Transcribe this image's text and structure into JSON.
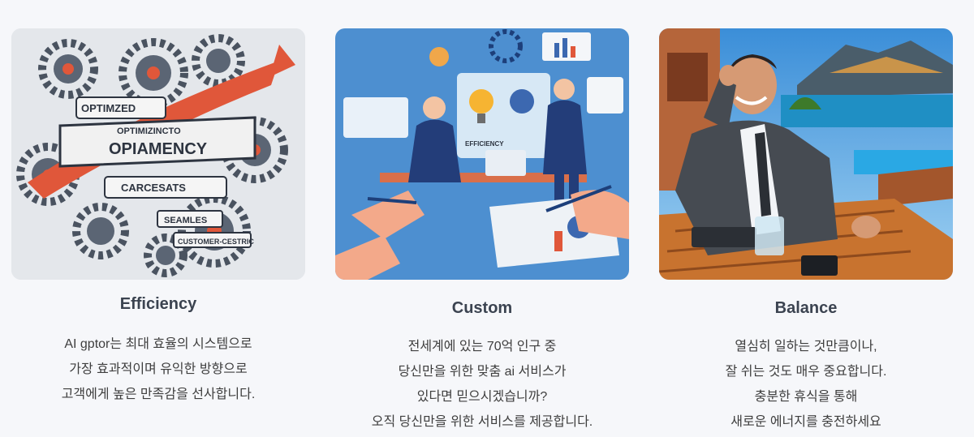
{
  "cards": [
    {
      "title": "Efficiency",
      "image_alt": "gears illustration",
      "image_words": [
        "OPTIMZED",
        "OPTIMIZINCTO",
        "OPIAMENCY",
        "CARCESATS",
        "SEAMLES",
        "CUSTOMER-CESTRIC"
      ],
      "lines": [
        "AI gptor는 최대 효율의 시스템으로",
        "가장 효과적이며 유익한 방향으로",
        "고객에게 높은 만족감을 선사합니다."
      ]
    },
    {
      "title": "Custom",
      "image_alt": "business meeting illustration",
      "image_words": [
        "EFFICIENCY"
      ],
      "lines": [
        "전세계에 있는 70억 인구 중",
        "당신만을 위한 맞춤 ai 서비스가",
        "있다면 믿으시겠습니까?",
        "오직 당신만을 위한 서비스를 제공합니다."
      ]
    },
    {
      "title": "Balance",
      "image_alt": "relaxed businessman at resort",
      "lines": [
        "열심히 일하는 것만큼이나,",
        "잘 쉬는 것도 매우 중요합니다.",
        "충분한 휴식을 통해",
        "새로운 에너지를 충전하세요"
      ]
    }
  ],
  "colors": {
    "background": "#f6f7fa",
    "title": "#3b4350",
    "text": "#3e3e3e"
  }
}
